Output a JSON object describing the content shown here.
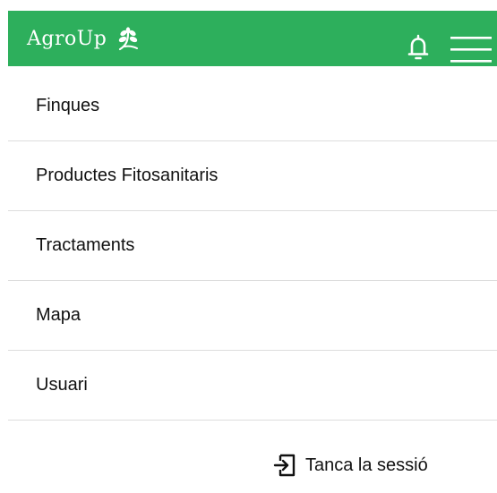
{
  "header": {
    "brand": "AgroUp",
    "accent_color": "#2daf5c",
    "logo_icon": "leaf-icon",
    "notification_icon": "bell-icon",
    "menu_icon": "hamburger-menu-icon"
  },
  "menu": {
    "items": [
      {
        "label": "Finques"
      },
      {
        "label": "Productes Fitosanitaris"
      },
      {
        "label": "Tractaments"
      },
      {
        "label": "Mapa"
      },
      {
        "label": "Usuari"
      }
    ]
  },
  "logout": {
    "label": "Tanca la sessió",
    "icon": "logout-icon"
  }
}
